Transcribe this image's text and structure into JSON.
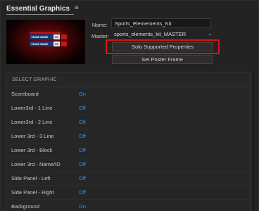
{
  "panel": {
    "title": "Essential Graphics",
    "menu_icon": "hamburger-icon"
  },
  "poster": {
    "colors": {
      "background": "#5a0808",
      "team_bar": "#153a7a",
      "accent": "#c01818"
    },
    "scoreboard": [
      {
        "team": "TEAM NAME",
        "score": "00"
      },
      {
        "team": "TEAM NAME",
        "score": "00"
      }
    ]
  },
  "fields": {
    "name_label": "Name:",
    "name_value": "Sports_Elemements_Kit",
    "master_label": "Master:",
    "master_value": "sports_elements_kit_MASTER",
    "master_icon": "chevron-down-icon"
  },
  "buttons": {
    "solo": "Solo Supported Properties",
    "poster_frame": "Set Poster Frame",
    "highlight_color": "#e01010"
  },
  "properties": {
    "section_title": "SELECT GRAPHIC",
    "value_color": "#2f8ff5",
    "rows": [
      {
        "label": "Scoreboard",
        "value": "On"
      },
      {
        "label": "Lower3rd - 1 Line",
        "value": "Off"
      },
      {
        "label": "Lower3rd - 2 Line",
        "value": "Off"
      },
      {
        "label": "Lower 3rd - 3 Line",
        "value": "Off"
      },
      {
        "label": "Lower 3rd - Block",
        "value": "Off"
      },
      {
        "label": "Lower 3rd - Name/ID",
        "value": "Off"
      },
      {
        "label": "Side Panel - Left",
        "value": "Off"
      },
      {
        "label": "Side Panel - Right",
        "value": "Off"
      },
      {
        "label": "Background",
        "value": "On"
      }
    ]
  }
}
